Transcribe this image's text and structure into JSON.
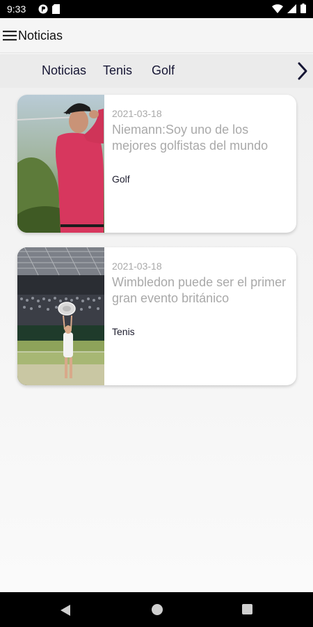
{
  "status_bar": {
    "time": "9:33",
    "left_icons": [
      "p-circle-icon",
      "sd-card-icon"
    ],
    "right_icons": [
      "wifi-icon",
      "signal-icon",
      "battery-icon"
    ]
  },
  "app_bar": {
    "title": "Noticias",
    "menu_icon": "hamburger-menu-icon"
  },
  "tabs": {
    "items": [
      {
        "label": "Noticias"
      },
      {
        "label": "Tenis"
      },
      {
        "label": "Golf"
      }
    ],
    "more_icon": "chevron-right-icon"
  },
  "news": [
    {
      "date": "2021-03-18",
      "title": "Niemann:Soy uno de los mejores golfistas del mundo",
      "category": "Golf",
      "image": "golfer-photo"
    },
    {
      "date": "2021-03-18",
      "title": "Wimbledon puede ser el primer gran evento británico",
      "category": "Tenis",
      "image": "wimbledon-trophy-photo"
    }
  ],
  "nav_bar": {
    "icons": [
      "back-icon",
      "home-icon",
      "recents-icon"
    ]
  },
  "colors": {
    "tab_text": "#161634",
    "muted_text": "#a9a9a9",
    "card_bg": "#ffffff"
  }
}
